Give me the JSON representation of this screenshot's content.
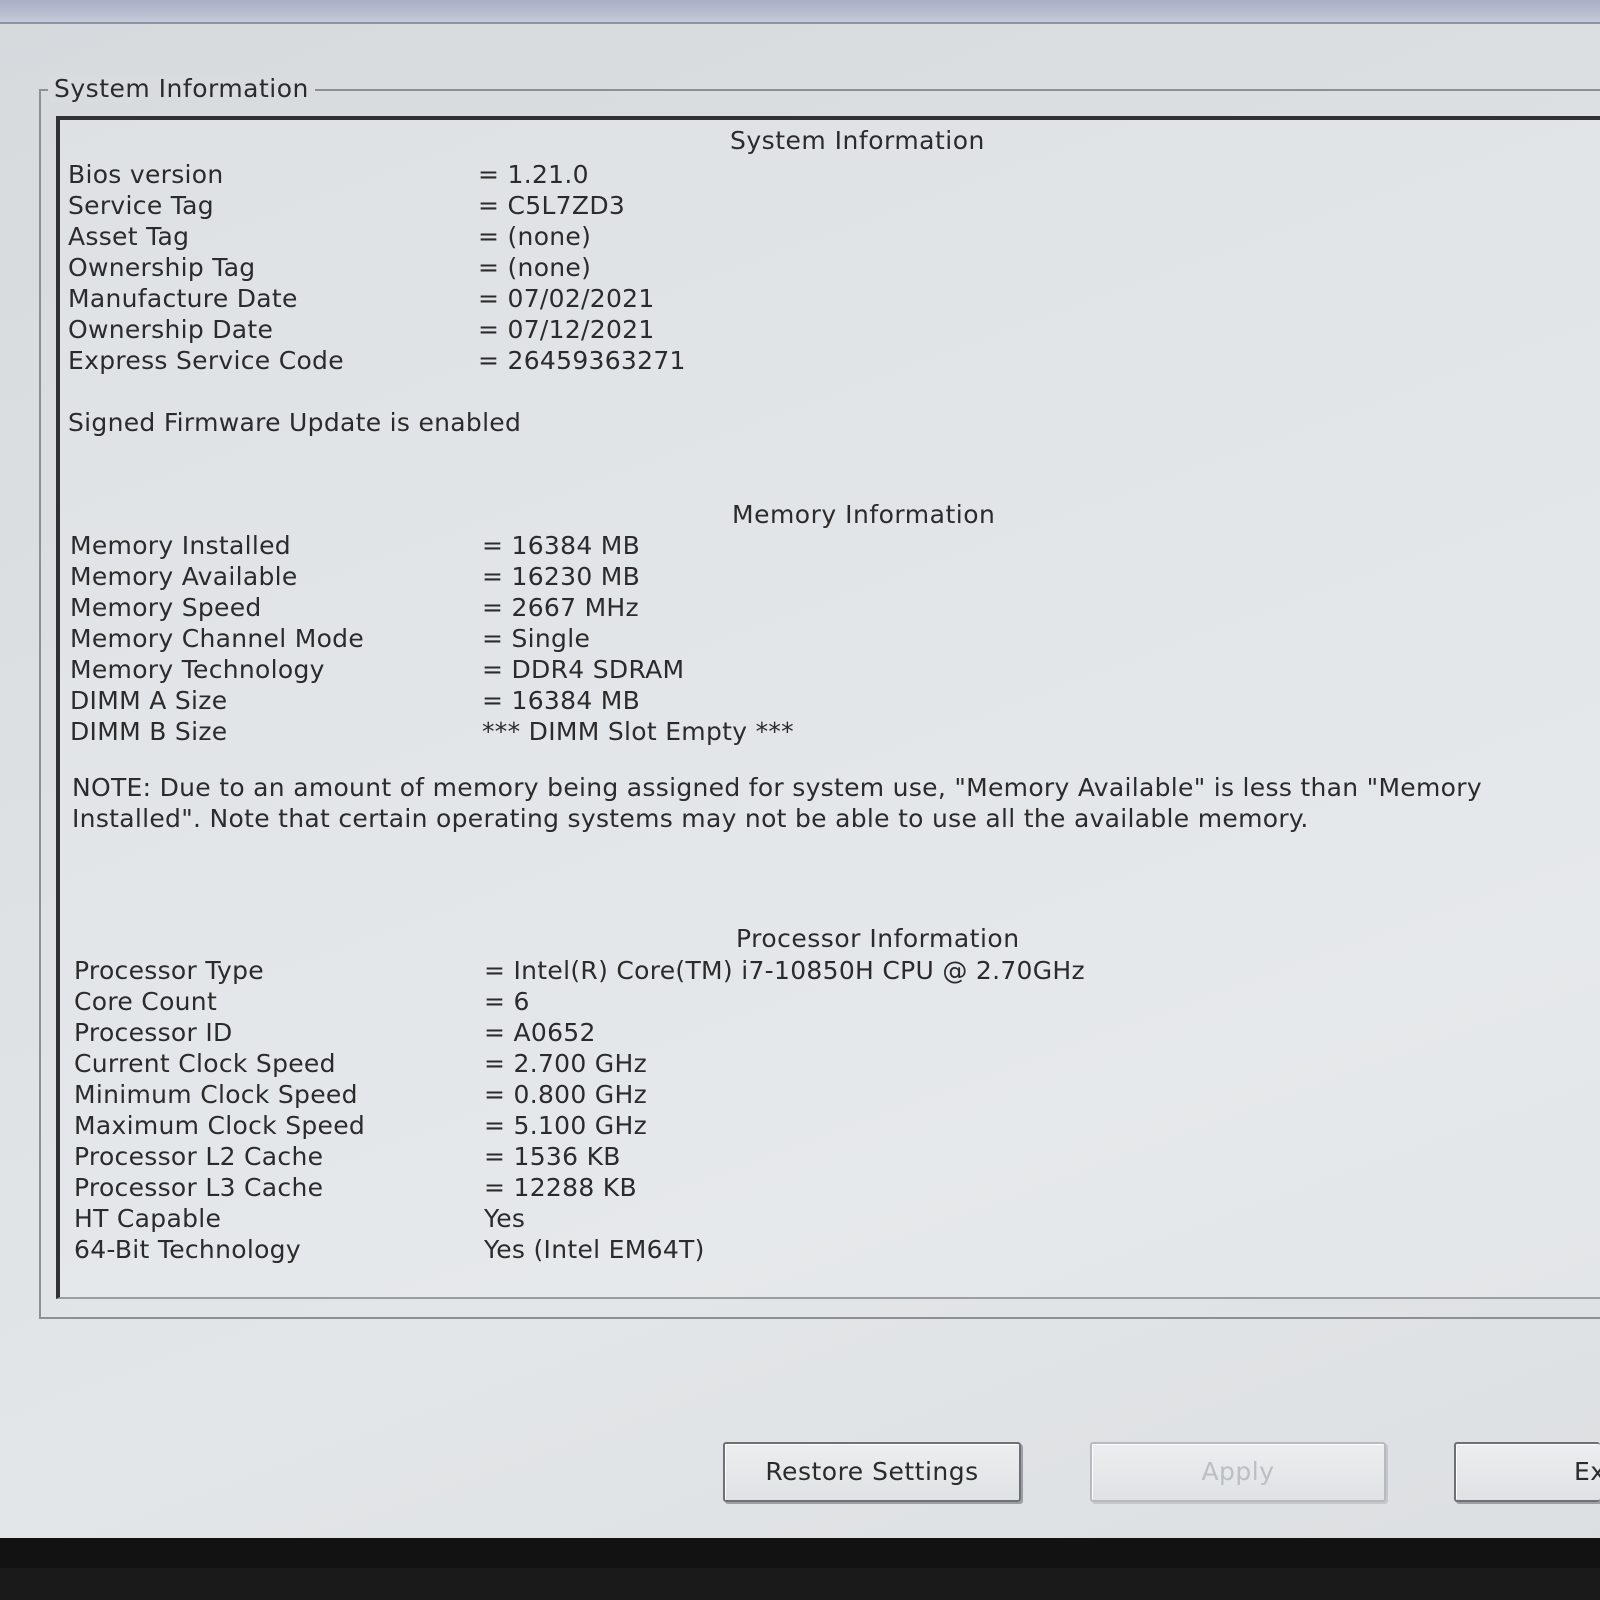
{
  "groupbox": {
    "title": "System Information"
  },
  "system": {
    "title": "System Information",
    "rows": [
      {
        "label": "Bios version",
        "value": "= 1.21.0"
      },
      {
        "label": "Service Tag",
        "value": "= C5L7ZD3"
      },
      {
        "label": "Asset Tag",
        "value": "= (none)"
      },
      {
        "label": "Ownership Tag",
        "value": "= (none)"
      },
      {
        "label": "Manufacture Date",
        "value": "= 07/02/2021"
      },
      {
        "label": "Ownership Date",
        "value": "= 07/12/2021"
      },
      {
        "label": "Express Service Code",
        "value": "= 26459363271"
      }
    ],
    "firmware_note": "Signed Firmware Update is enabled"
  },
  "memory": {
    "title": "Memory Information",
    "rows": [
      {
        "label": "Memory Installed",
        "value": "= 16384 MB"
      },
      {
        "label": "Memory Available",
        "value": "= 16230 MB"
      },
      {
        "label": "Memory Speed",
        "value": "= 2667 MHz"
      },
      {
        "label": "Memory Channel Mode",
        "value": "= Single"
      },
      {
        "label": "Memory Technology",
        "value": "= DDR4 SDRAM"
      },
      {
        "label": "DIMM A Size",
        "value": "= 16384 MB"
      },
      {
        "label": "DIMM B Size",
        "value": "*** DIMM Slot Empty ***"
      }
    ],
    "note": "NOTE: Due to an amount of memory being assigned for system use, \"Memory Available\" is less than \"Memory Installed\". Note that certain operating systems may not be able to use all the available memory."
  },
  "processor": {
    "title": "Processor Information",
    "rows": [
      {
        "label": "Processor Type",
        "value": "= Intel(R) Core(TM) i7-10850H CPU @ 2.70GHz"
      },
      {
        "label": "Core Count",
        "value": "= 6"
      },
      {
        "label": "Processor ID",
        "value": "= A0652"
      },
      {
        "label": "Current Clock Speed",
        "value": "= 2.700 GHz"
      },
      {
        "label": "Minimum Clock Speed",
        "value": "= 0.800 GHz"
      },
      {
        "label": "Maximum Clock Speed",
        "value": "= 5.100 GHz"
      },
      {
        "label": "Processor L2 Cache",
        "value": "= 1536 KB"
      },
      {
        "label": "Processor L3 Cache",
        "value": "= 12288 KB"
      },
      {
        "label": "HT Capable",
        "value": "Yes"
      },
      {
        "label": "64-Bit Technology",
        "value": "Yes (Intel EM64T)"
      }
    ]
  },
  "buttons": {
    "restore": "Restore Settings",
    "apply": "Apply",
    "exit": "Ex"
  }
}
